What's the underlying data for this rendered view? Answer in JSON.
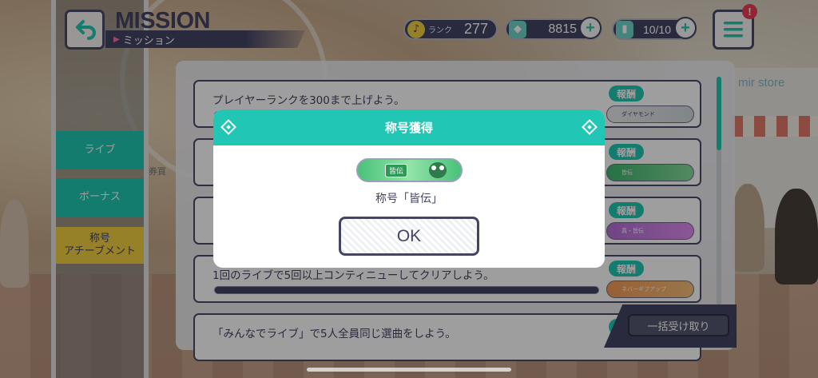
{
  "header": {
    "title": "MISSION",
    "subtitle": "ミッション",
    "back_icon": "back-arrow-icon",
    "menu_icon": "hamburger-menu-icon",
    "menu_badge": "!"
  },
  "status": {
    "rank_label": "ランク",
    "rank_value": "277",
    "gems": "8815",
    "energy": "10/10",
    "plus_label": "+"
  },
  "side_tabs": [
    {
      "label": "ライブ"
    },
    {
      "label": "ボーナス"
    },
    {
      "label": "称号\nアチーブメント"
    }
  ],
  "missions": [
    {
      "text": "プレイヤーランクを300まで上げよう。",
      "reward_tag": "報酬",
      "reward_item": "ダイヤモンド"
    },
    {
      "text": "",
      "reward_tag": "報酬",
      "reward_item": "皆伝"
    },
    {
      "text": "",
      "reward_tag": "報酬",
      "reward_item": "真・皆伝"
    },
    {
      "text": "1回のライブで5回以上コンティニューしてクリアしよう。",
      "reward_tag": "報酬",
      "reward_item": "ネバーギブアップ"
    },
    {
      "text": "「みんなでライブ」で5人全員同じ選曲をしよう。",
      "reward_tag": "報酬",
      "reward_item": ""
    }
  ],
  "background_text": "券買",
  "collect_all": "一括受け取り",
  "modal": {
    "title": "称号獲得",
    "badge_label": "皆伝",
    "message": "称号「皆伝」",
    "ok": "OK"
  },
  "colors": {
    "accent": "#21c7b4",
    "navy": "#444466",
    "yellow_tab": "#f2d043",
    "badge_red": "#ee3b53"
  }
}
